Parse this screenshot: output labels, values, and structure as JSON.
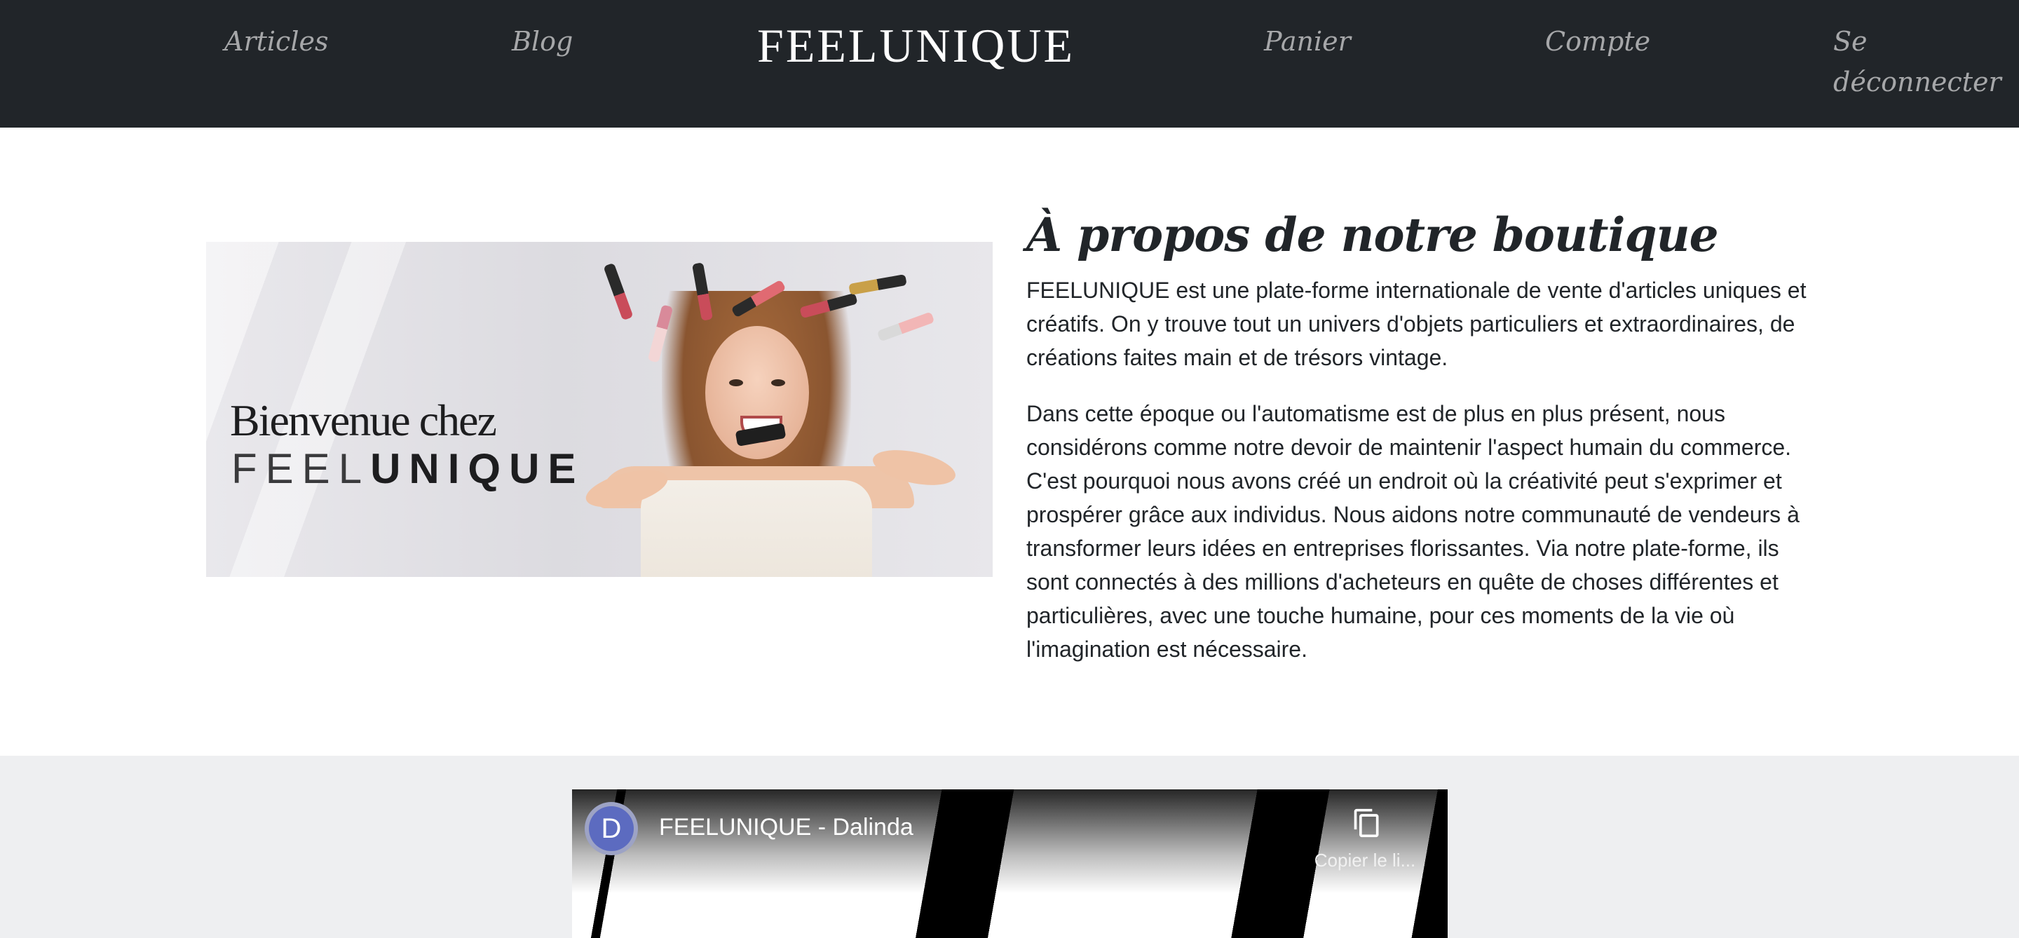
{
  "navbar": {
    "brand": "FEELUNIQUE",
    "links": [
      "Articles",
      "Blog",
      "Panier",
      "Compte",
      "Se déconnecter"
    ]
  },
  "hero_image": {
    "line1": "Bienvenue chez",
    "line2_light": "FEEL",
    "line2_bold": "UNIQUE"
  },
  "about": {
    "title": "À propos de notre boutique",
    "paragraphs": [
      "FEELUNIQUE est une plate-forme internationale de vente d'articles uniques et créatifs. On y trouve tout un univers d'objets particuliers et extraordinaires, de créations faites main et de trésors vintage.",
      "Dans cette époque ou l'automatisme est de plus en plus présent, nous considérons comme notre devoir de maintenir l'aspect humain du commerce. C'est pourquoi nous avons créé un endroit où la créativité peut s'exprimer et prospérer grâce aux individus. Nous aidons notre communauté de vendeurs à transformer leurs idées en entreprises florissantes. Via notre plate-forme, ils sont connectés à des millions d'acheteurs en quête de choses différentes et particulières, avec une touche humaine, pour ces moments de la vie où l'imagination est nécessaire."
    ]
  },
  "video": {
    "channel_initial": "D",
    "title": "FEELUNIQUE - Dalinda",
    "copy_label": "Copier le li...",
    "copy_icon": "copy-icon"
  },
  "colors": {
    "navbar_bg": "#212529",
    "nav_link": "rgba(255,255,255,0.6)",
    "section_bg": "#eeeff1",
    "avatar_bg": "#5c6bc0"
  }
}
